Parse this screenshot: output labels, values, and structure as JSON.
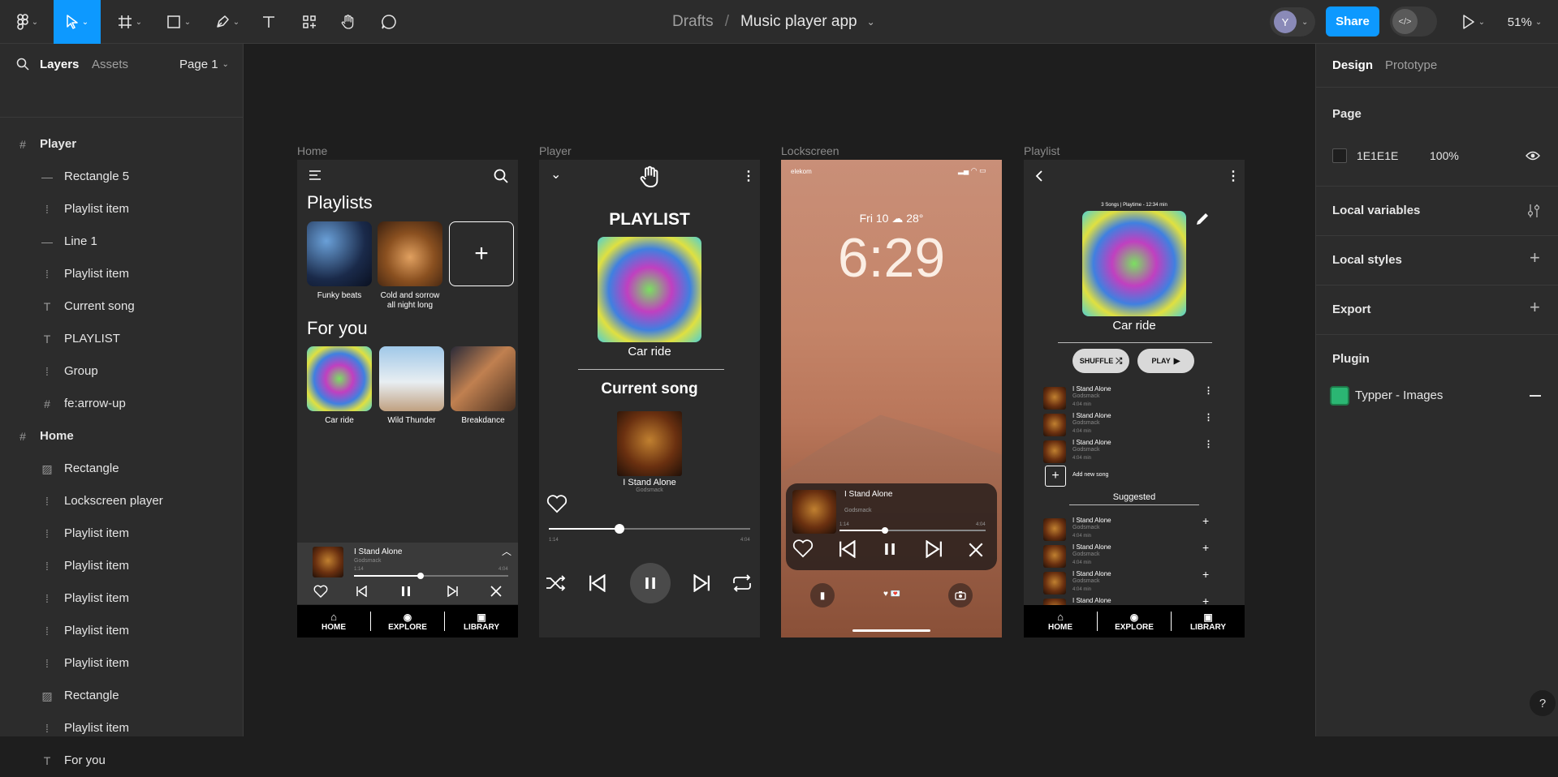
{
  "toolbar": {
    "breadcrumb_parent": "Drafts",
    "breadcrumb_separator": "/",
    "file_name": "Music player app",
    "avatar_letter": "Y",
    "share_label": "Share",
    "zoom": "51%"
  },
  "left_panel": {
    "tabs": [
      "Layers",
      "Assets"
    ],
    "page_label": "Page 1",
    "layers": [
      {
        "name": "Player",
        "kind": "frame",
        "top": true
      },
      {
        "name": "Rectangle 5",
        "kind": "line"
      },
      {
        "name": "Playlist item",
        "kind": "component"
      },
      {
        "name": "Line 1",
        "kind": "line"
      },
      {
        "name": "Playlist item",
        "kind": "component"
      },
      {
        "name": "Current song",
        "kind": "text"
      },
      {
        "name": "PLAYLIST",
        "kind": "text"
      },
      {
        "name": "Group",
        "kind": "component"
      },
      {
        "name": "fe:arrow-up",
        "kind": "frame"
      },
      {
        "name": "Home",
        "kind": "frame",
        "top": true
      },
      {
        "name": "Rectangle",
        "kind": "image"
      },
      {
        "name": "Lockscreen player",
        "kind": "component"
      },
      {
        "name": "Playlist item",
        "kind": "component"
      },
      {
        "name": "Playlist item",
        "kind": "component"
      },
      {
        "name": "Playlist item",
        "kind": "component"
      },
      {
        "name": "Playlist item",
        "kind": "component"
      },
      {
        "name": "Playlist item",
        "kind": "component"
      },
      {
        "name": "Rectangle",
        "kind": "image"
      },
      {
        "name": "Playlist item",
        "kind": "component"
      },
      {
        "name": "For you",
        "kind": "text"
      }
    ]
  },
  "right_panel": {
    "tabs": [
      "Design",
      "Prototype"
    ],
    "page_title": "Page",
    "page_color": "1E1E1E",
    "page_opacity": "100%",
    "local_variables": "Local variables",
    "local_styles": "Local styles",
    "export": "Export",
    "plugin_title": "Plugin",
    "plugin_name": "Typper - Images",
    "help": "?"
  },
  "frames": {
    "home": {
      "label": "Home",
      "playlists_title": "Playlists",
      "playlists": [
        {
          "name": "Funky beats",
          "art": "space"
        },
        {
          "name": "Cold and sorrow all night long",
          "art": "food"
        }
      ],
      "add_symbol": "+",
      "for_you_title": "For you",
      "for_you": [
        {
          "name": "Car ride",
          "art": "bug"
        },
        {
          "name": "Wild Thunder",
          "art": "bird"
        },
        {
          "name": "Breakdance",
          "art": "hall"
        }
      ],
      "mini_player": {
        "title": "I Stand Alone",
        "artist": "Godsmack",
        "elapsed": "1:14",
        "total": "4:04",
        "progress": 0.43
      },
      "nav": [
        "HOME",
        "EXPLORE",
        "LIBRARY"
      ]
    },
    "player": {
      "label": "Player",
      "playlist_heading": "PLAYLIST",
      "playlist_name": "Car ride",
      "current_heading": "Current song",
      "song_title": "I Stand Alone",
      "song_artist": "Godsmack",
      "elapsed": "1:14",
      "total": "4:04",
      "progress": 0.35
    },
    "lockscreen": {
      "label": "Lockscreen",
      "carrier": "elekom",
      "date_weather": "Fri 10",
      "temperature": "28°",
      "time": "6:29",
      "song_title": "I Stand Alone",
      "song_artist": "Godsmack",
      "elapsed": "1:14",
      "total": "4:04",
      "progress": 0.31,
      "focus_text": "♥ 💌"
    },
    "playlist": {
      "label": "Playlist",
      "meta": "3 Songs | Playtime - 12:34 min",
      "name": "Car ride",
      "shuffle": "SHUFFLE",
      "play": "PLAY",
      "songs": [
        {
          "title": "I Stand Alone",
          "artist": "Godsmack",
          "length": "4:04 min"
        },
        {
          "title": "I Stand Alone",
          "artist": "Godsmack",
          "length": "4:04 min"
        },
        {
          "title": "I Stand Alone",
          "artist": "Godsmack",
          "length": "4:04 min"
        }
      ],
      "add_song": "Add new song",
      "suggested_title": "Suggested",
      "suggested": [
        {
          "title": "I Stand Alone",
          "artist": "Godsmack",
          "length": "4:04 min"
        },
        {
          "title": "I Stand Alone",
          "artist": "Godsmack",
          "length": "4:04 min"
        },
        {
          "title": "I Stand Alone",
          "artist": "Godsmack",
          "length": "4:04 min"
        },
        {
          "title": "I Stand Alone",
          "artist": "",
          "length": ""
        }
      ],
      "nav": [
        "HOME",
        "EXPLORE",
        "LIBRARY"
      ]
    }
  },
  "colors": {
    "accent": "#0d99ff",
    "panel": "#2c2c2c",
    "canvas": "#1e1e1e",
    "app_bg": "#2b2b2b"
  }
}
